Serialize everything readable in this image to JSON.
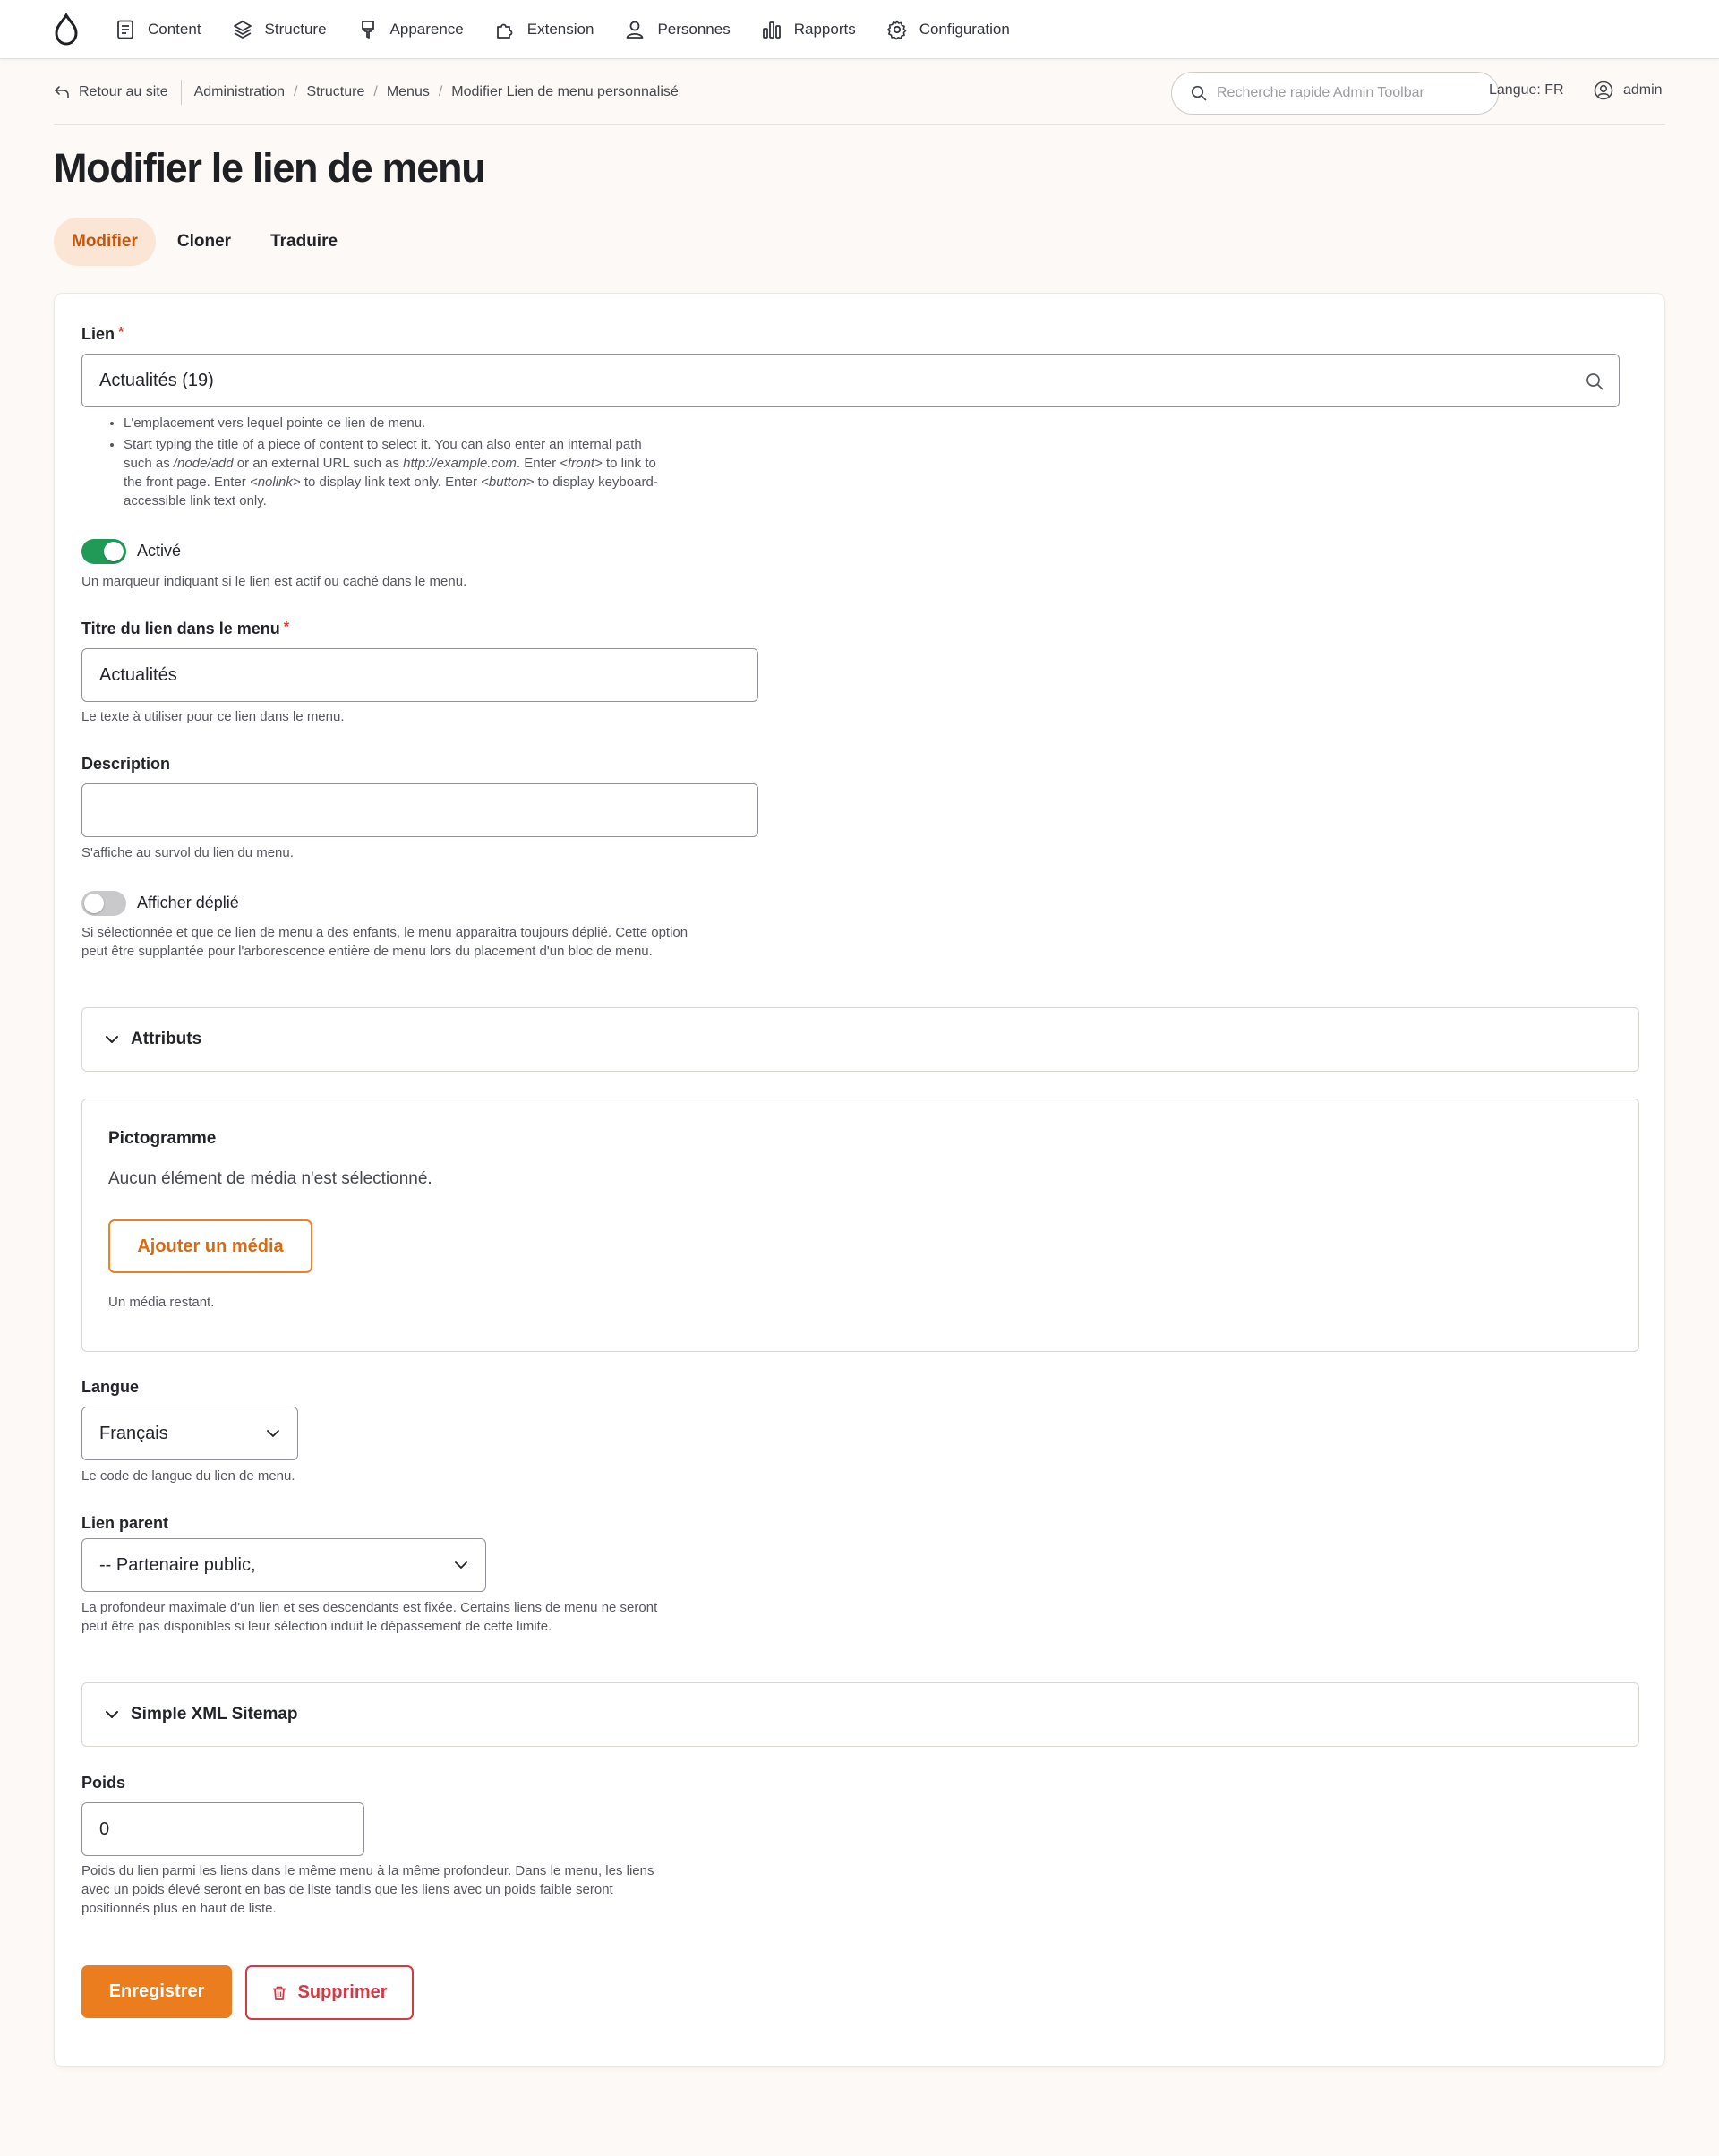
{
  "toolbar": {
    "items": [
      {
        "label": "Content",
        "icon": "document-icon"
      },
      {
        "label": "Structure",
        "icon": "layers-icon"
      },
      {
        "label": "Apparence",
        "icon": "brush-icon"
      },
      {
        "label": "Extension",
        "icon": "puzzle-icon"
      },
      {
        "label": "Personnes",
        "icon": "person-icon"
      },
      {
        "label": "Rapports",
        "icon": "bar-chart-icon"
      },
      {
        "label": "Configuration",
        "icon": "gear-icon"
      }
    ]
  },
  "breadcrumb": {
    "back_label": "Retour au site",
    "items": [
      "Administration",
      "Structure",
      "Menus",
      "Modifier Lien de menu personnalisé"
    ]
  },
  "search": {
    "placeholder": "Recherche rapide Admin Toolbar"
  },
  "header": {
    "language": "Langue: FR",
    "user": "admin"
  },
  "page": {
    "title": "Modifier le lien de menu"
  },
  "tabs": [
    {
      "label": "Modifier",
      "active": true
    },
    {
      "label": "Cloner",
      "active": false
    },
    {
      "label": "Traduire",
      "active": false
    }
  ],
  "form": {
    "link": {
      "label": "Lien",
      "required_mark": "*",
      "value": "Actualités (19)",
      "help_1": "L'emplacement vers lequel pointe ce lien de menu.",
      "help_2_a": "Start typing the title of a piece of content to select it. You can also enter an internal path such as ",
      "help_2_b": "/node/add",
      "help_2_c": " or an external URL such as ",
      "help_2_d": "http://example.com",
      "help_2_e": ". Enter ",
      "help_2_f": "<front>",
      "help_2_g": " to link to the front page. Enter ",
      "help_2_h": "<nolink>",
      "help_2_i": " to display link text only. Enter ",
      "help_2_j": "<button>",
      "help_2_k": " to display keyboard-accessible link text only."
    },
    "enabled": {
      "label": "Activé",
      "checked": true,
      "help": "Un marqueur indiquant si le lien est actif ou caché dans le menu."
    },
    "title": {
      "label": "Titre du lien dans le menu",
      "required_mark": "*",
      "value": "Actualités",
      "help": "Le texte à utiliser pour ce lien dans le menu."
    },
    "description": {
      "label": "Description",
      "value": "",
      "help": "S'affiche au survol du lien du menu."
    },
    "expanded": {
      "label": "Afficher déplié",
      "checked": false,
      "help": "Si sélectionnée et que ce lien de menu a des enfants, le menu apparaîtra toujours déplié. Cette option peut être supplantée pour l'arborescence entière de menu lors du placement d'un bloc de menu."
    },
    "attributes": {
      "label": "Attributs"
    },
    "pictogram": {
      "label": "Pictogramme",
      "empty_text": "Aucun élément de média n'est sélectionné.",
      "add_button": "Ajouter un média",
      "remaining": "Un média restant."
    },
    "language": {
      "label": "Langue",
      "selected": "Français",
      "help": "Le code de langue du lien de menu."
    },
    "parent": {
      "label": "Lien parent",
      "selected": "-- Partenaire public,",
      "help": "La profondeur maximale d'un lien et ses descendants est fixée. Certains liens de menu ne seront peut être pas disponibles si leur sélection induit le dépassement de cette limite."
    },
    "sitemap": {
      "label": "Simple XML Sitemap"
    },
    "weight": {
      "label": "Poids",
      "value": "0",
      "help": "Poids du lien parmi les liens dans le même menu à la même profondeur. Dans le menu, les liens avec un poids élevé seront en bas de liste tandis que les liens avec un poids faible seront positionnés plus en haut de liste."
    },
    "actions": {
      "save": "Enregistrer",
      "delete": "Supprimer"
    }
  },
  "colors": {
    "accent": "#ec7d1f",
    "tab_active_bg": "#fbe6d6",
    "toggle_on": "#1f9a57",
    "danger": "#d23a46",
    "page_bg": "#fdf9f6"
  }
}
